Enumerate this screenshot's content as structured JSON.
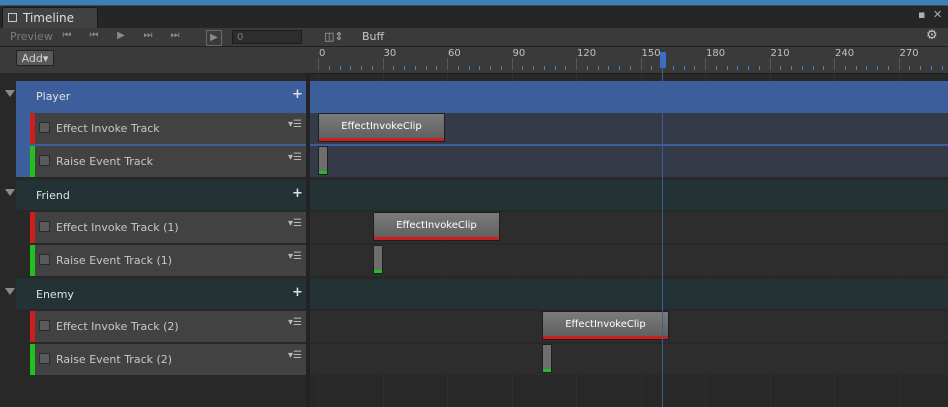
{
  "window": {
    "tab_title": "Timeline",
    "controls": [
      "▪",
      "✕"
    ]
  },
  "toolbar": {
    "preview_label": "Preview",
    "buttons": [
      "⏮",
      "⏮",
      "▶",
      "⏭",
      "⏭"
    ],
    "frame_toggle": "▶",
    "frame_value": "0",
    "asset_name": "Buff",
    "settings_icon": "gear-icon"
  },
  "add_button": {
    "label": "Add"
  },
  "ruler": {
    "labels": [
      "0",
      "30",
      "60",
      "90",
      "120",
      "150",
      "180",
      "210",
      "240",
      "270"
    ],
    "playhead_frame": 160
  },
  "groups": [
    {
      "name": "Player",
      "tracks": [
        {
          "name": "Effect Invoke Track",
          "type": "effect",
          "clip": "EffectInvokeClip"
        },
        {
          "name": "Raise Event Track",
          "type": "event"
        }
      ]
    },
    {
      "name": "Friend",
      "tracks": [
        {
          "name": "Effect Invoke Track (1)",
          "type": "effect",
          "clip": "EffectInvokeClip"
        },
        {
          "name": "Raise Event Track (1)",
          "type": "event"
        }
      ]
    },
    {
      "name": "Enemy",
      "tracks": [
        {
          "name": "Effect Invoke Track (2)",
          "type": "effect",
          "clip": "EffectInvokeClip"
        },
        {
          "name": "Raise Event Track (2)",
          "type": "event"
        }
      ]
    }
  ],
  "colors": {
    "selected_group": "#3c5f9b",
    "effect_track": "#cc1e1e",
    "event_track": "#20c020",
    "playhead": "#3b6ec6"
  }
}
